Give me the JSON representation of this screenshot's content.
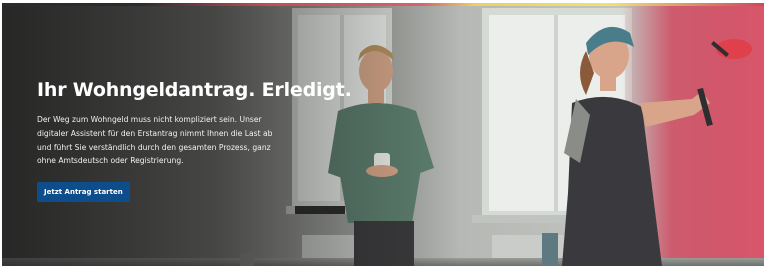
{
  "hero": {
    "headline": "Ihr Wohngeldantrag. Erledigt.",
    "body": "Der Weg zum Wohngeld muss nicht kompliziert sein. Unser digitaler Assistent für den Erstantrag nimmt Ihnen die Last ab und führt Sie verständlich durch den gesamten Prozess, ganz ohne Amtsdeutsch oder Registrierung.",
    "cta_label": "Jetzt Antrag starten",
    "colors": {
      "cta_background": "#0d4d8c",
      "headline_text": "#ffffff",
      "wall_accent": "#d8485e"
    }
  }
}
